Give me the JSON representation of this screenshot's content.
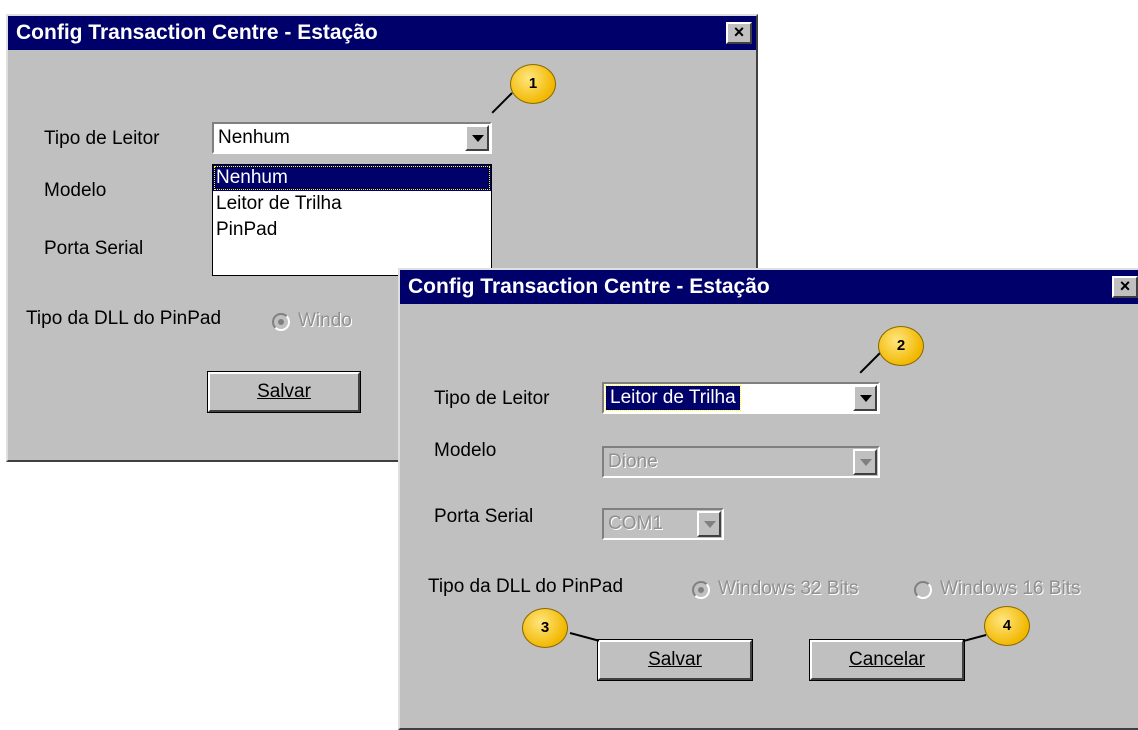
{
  "dialog1": {
    "title": "Config Transaction Centre - Estação",
    "close_label": "×",
    "tipo_leitor_label": "Tipo de Leitor",
    "tipo_leitor_value": "Nenhum",
    "modelo_label": "Modelo",
    "porta_serial_label": "Porta Serial",
    "dll_label": "Tipo da DLL  do PinPad",
    "radio1_label": "Windo",
    "dropdown_options": [
      "Nenhum",
      "Leitor de Trilha",
      "PinPad"
    ],
    "salvar_label": "Salvar"
  },
  "dialog2": {
    "title": "Config Transaction Centre - Estação",
    "close_label": "×",
    "tipo_leitor_label": "Tipo de Leitor",
    "tipo_leitor_value": "Leitor de Trilha",
    "modelo_label": "Modelo",
    "modelo_value": "Dione",
    "porta_serial_label": "Porta Serial",
    "porta_serial_value": "COM1",
    "dll_label": "Tipo da DLL  do PinPad",
    "radio1_label": "Windows 32 Bits",
    "radio2_label": "Windows 16 Bits",
    "salvar_label": "Salvar",
    "cancelar_label": "Cancelar"
  },
  "callouts": [
    "1",
    "2",
    "3",
    "4"
  ],
  "colors": {
    "titlebar": "#00006b",
    "face": "#c0c0c0",
    "callout": "#f2b800"
  }
}
